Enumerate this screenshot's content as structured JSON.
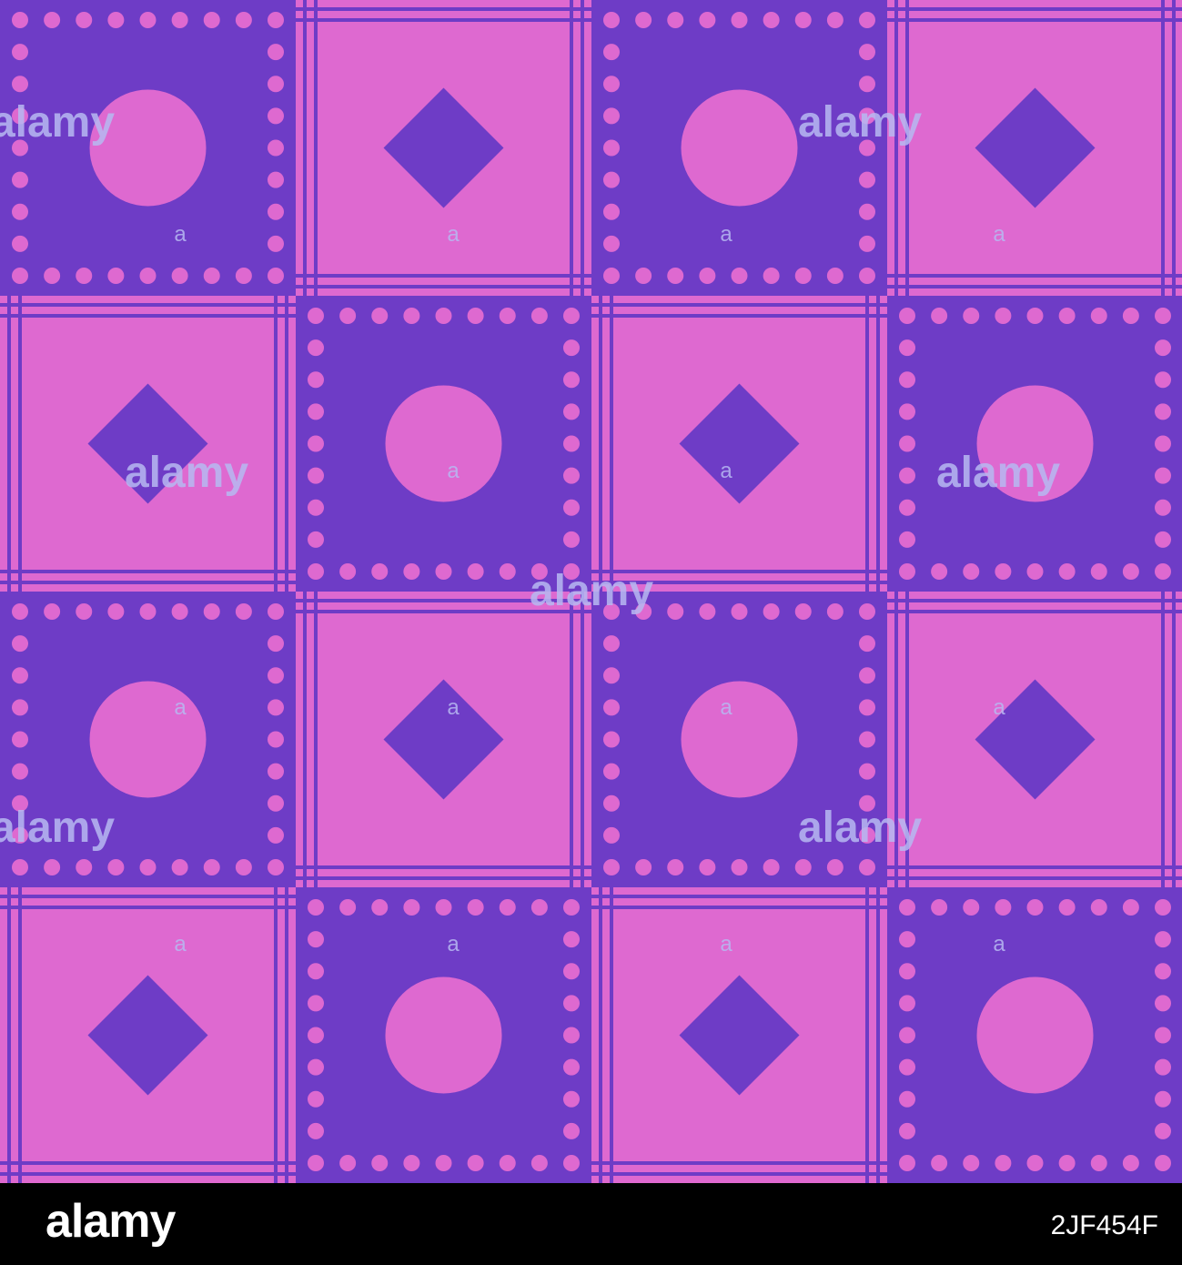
{
  "colors": {
    "violet": "#6e3cc6",
    "pink": "#de69d0",
    "footer_bg": "#000000",
    "watermark": "#b7b9f2"
  },
  "pattern": {
    "rows": 4,
    "cols": 4,
    "tile_types": [
      "circle",
      "diamond"
    ],
    "description_tiles": [
      [
        "circle",
        "diamond",
        "circle",
        "diamond"
      ],
      [
        "diamond",
        "circle",
        "diamond",
        "circle"
      ],
      [
        "circle",
        "diamond",
        "circle",
        "diamond"
      ],
      [
        "diamond",
        "circle",
        "diamond",
        "circle"
      ]
    ]
  },
  "watermark": {
    "text": "alamy",
    "small_mark": "a"
  },
  "footer": {
    "logo": "alamy",
    "image_id": "2JF454F"
  }
}
